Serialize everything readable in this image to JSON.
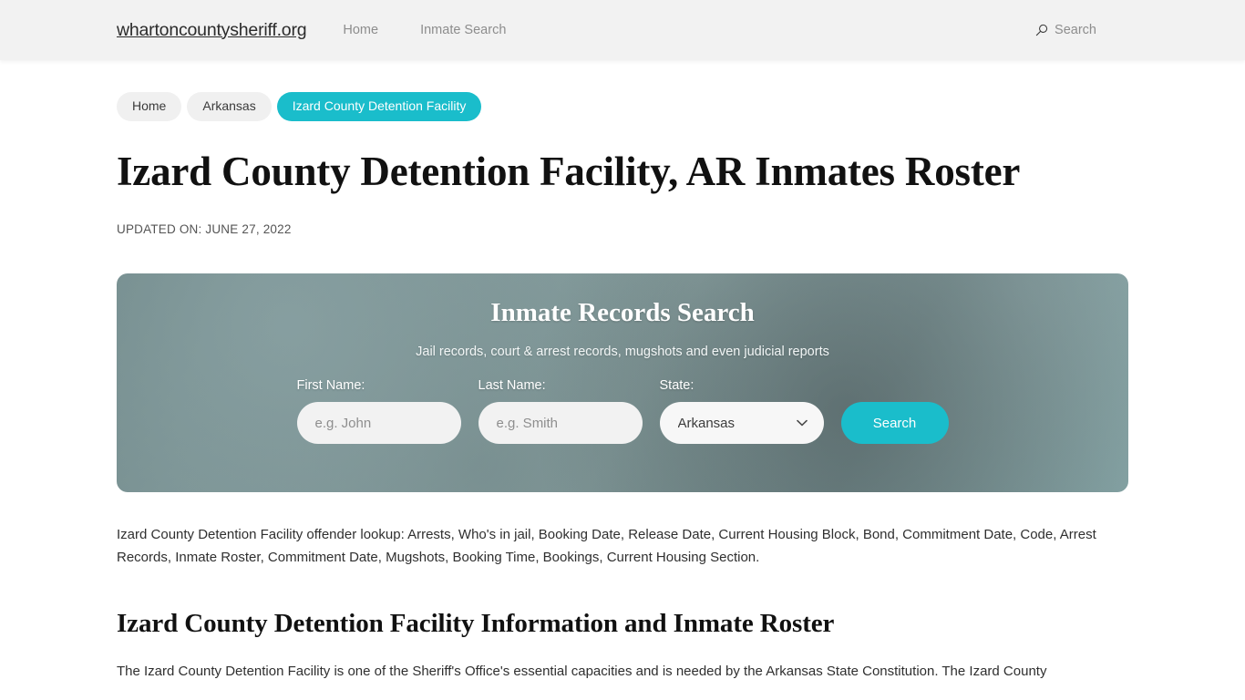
{
  "header": {
    "brand": "whartoncountysheriff.org",
    "nav": [
      {
        "label": "Home"
      },
      {
        "label": "Inmate Search"
      }
    ],
    "search": {
      "icon": "search-icon",
      "label": "Search"
    }
  },
  "breadcrumbs": [
    {
      "label": "Home",
      "current": false
    },
    {
      "label": "Arkansas",
      "current": false
    },
    {
      "label": "Izard County Detention Facility",
      "current": true
    }
  ],
  "main": {
    "title": "Izard County Detention Facility, AR Inmates Roster",
    "updated_on": "UPDATED ON: JUNE 27, 2022",
    "lead_paragraph": "Izard County Detention Facility offender lookup: Arrests, Who's in jail, Booking Date, Release Date, Current Housing Block, Bond, Commitment Date, Code, Arrest Records, Inmate Roster, Commitment Date, Mugshots, Booking Time, Bookings, Current Housing Section.",
    "section_heading": "Izard County Detention Facility Information and Inmate Roster",
    "section_paragraph": "The Izard County Detention Facility is one of the Sheriff's Office's essential capacities and is needed by the Arkansas State Constitution. The Izard County"
  },
  "search_panel": {
    "title": "Inmate Records Search",
    "subtitle": "Jail records, court & arrest records, mugshots and even judicial reports",
    "fields": {
      "first_name": {
        "label": "First Name:",
        "placeholder": "e.g. John",
        "value": ""
      },
      "last_name": {
        "label": "Last Name:",
        "placeholder": "e.g. Smith",
        "value": ""
      },
      "state": {
        "label": "State:",
        "selected": "Arkansas",
        "chevron_icon": "chevron-down-icon"
      }
    },
    "submit_label": "Search"
  },
  "colors": {
    "accent_teal": "#1abdcb",
    "header_bg": "#f2f2f2",
    "page_bg": "#ffffff",
    "crumb_bg": "#f0f0f0",
    "panel_base": "#7d9596"
  }
}
